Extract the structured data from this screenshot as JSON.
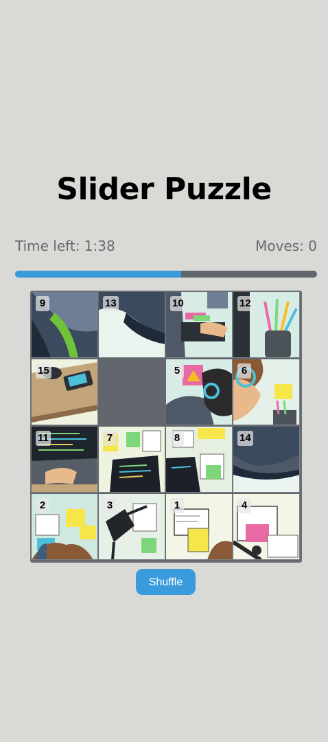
{
  "page": {
    "title": "Slider Puzzle",
    "time_left_label": "Time left: 1:38",
    "moves_label": "Moves: 0",
    "shuffle_label": "Shuffle"
  },
  "timer": {
    "remaining_fraction": 0.55
  },
  "board": {
    "rows": 4,
    "cols": 4,
    "tiles": [
      "9",
      "13",
      "10",
      "12",
      "15",
      "",
      "5",
      "6",
      "11",
      "7",
      "8",
      "14",
      "2",
      "3",
      "1",
      "4"
    ]
  },
  "colors": {
    "background": "#d9d9d6",
    "accent": "#3a9bdc",
    "track": "#62666d",
    "text_muted": "#666a70"
  }
}
